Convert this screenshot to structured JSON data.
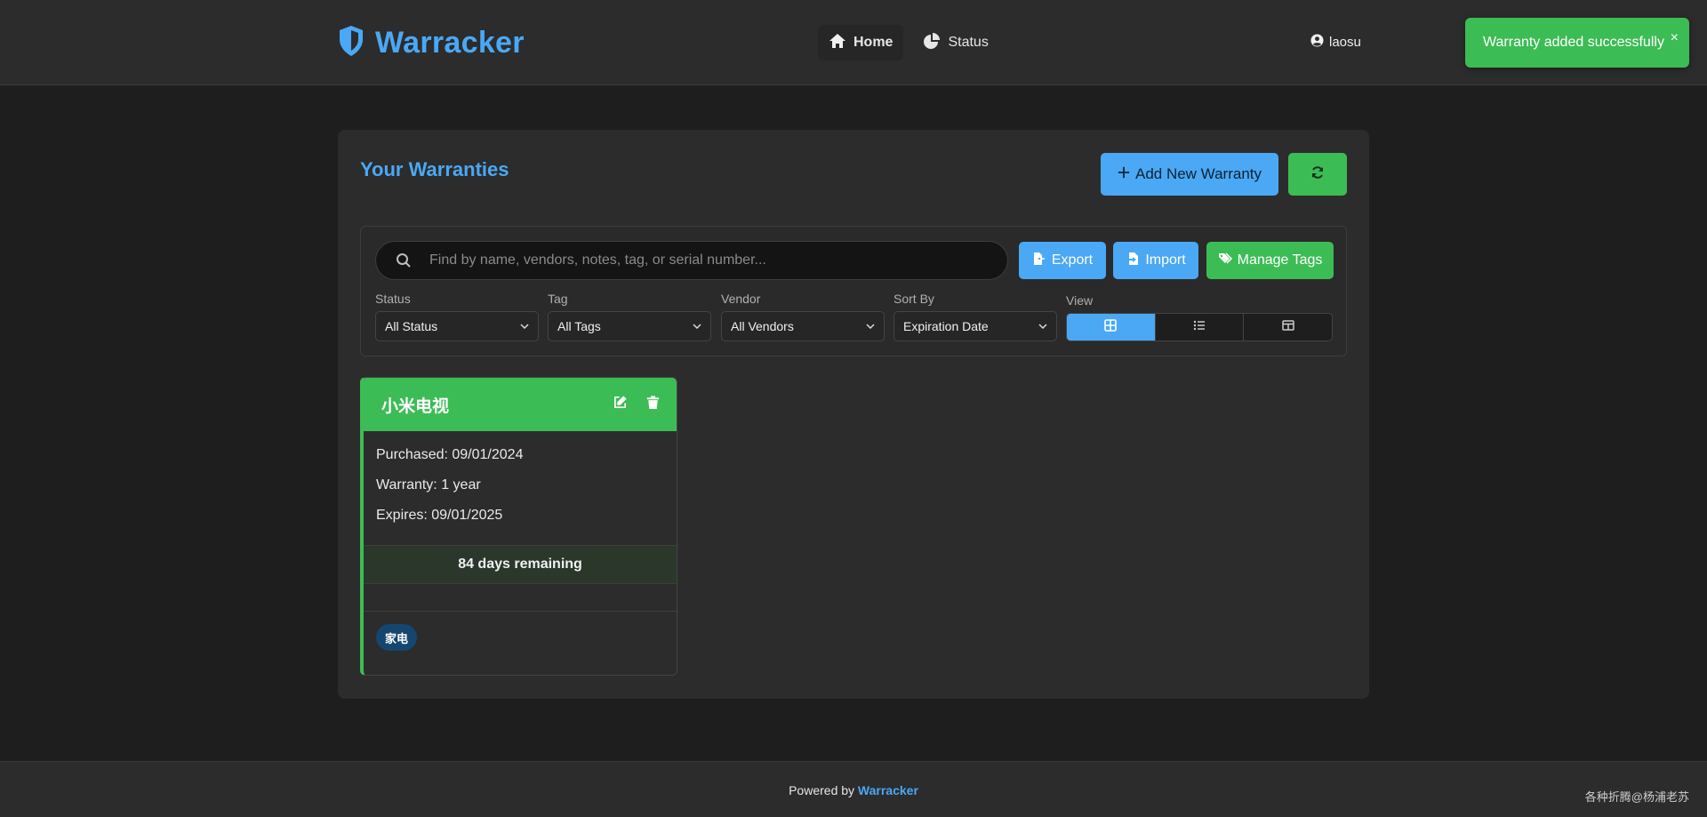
{
  "colors": {
    "accent_blue": "#4aa8f5",
    "accent_green": "#3cbc55",
    "background": "#1e1e1e",
    "panel": "#2c2c2c",
    "tag_pill": "#14466f"
  },
  "header": {
    "brand": "Warracker",
    "brand_icon": "shield-icon",
    "nav": [
      {
        "label": "Home",
        "icon": "home-icon",
        "active": true
      },
      {
        "label": "Status",
        "icon": "pie-chart-icon",
        "active": false
      }
    ],
    "user": {
      "name": "laosu",
      "icon": "user-circle-icon"
    }
  },
  "toast": {
    "message": "Warranty added successfully",
    "close": "×"
  },
  "main": {
    "title": "Your Warranties",
    "add_button": "Add New Warranty",
    "refresh_icon": "refresh-icon",
    "search": {
      "placeholder": "Find by name, vendors, notes, tag, or serial number...",
      "value": ""
    },
    "actions": {
      "export": "Export",
      "import": "Import",
      "manage_tags": "Manage Tags"
    },
    "filters": {
      "status": {
        "label": "Status",
        "value": "All Status"
      },
      "tag": {
        "label": "Tag",
        "value": "All Tags"
      },
      "vendor": {
        "label": "Vendor",
        "value": "All Vendors"
      },
      "sort": {
        "label": "Sort By",
        "value": "Expiration Date"
      },
      "view": {
        "label": "View",
        "options": [
          "grid",
          "list",
          "table"
        ],
        "selected": "grid"
      }
    }
  },
  "warranties": [
    {
      "name": "小米电视",
      "purchased": "Purchased: 09/01/2024",
      "warranty": "Warranty: 1 year",
      "expires": "Expires: 09/01/2025",
      "remaining": "84 days remaining",
      "tags": [
        "家电"
      ]
    }
  ],
  "footer": {
    "prefix": "Powered by",
    "link": "Warracker",
    "watermark": "各种折腾@杨浦老苏"
  }
}
